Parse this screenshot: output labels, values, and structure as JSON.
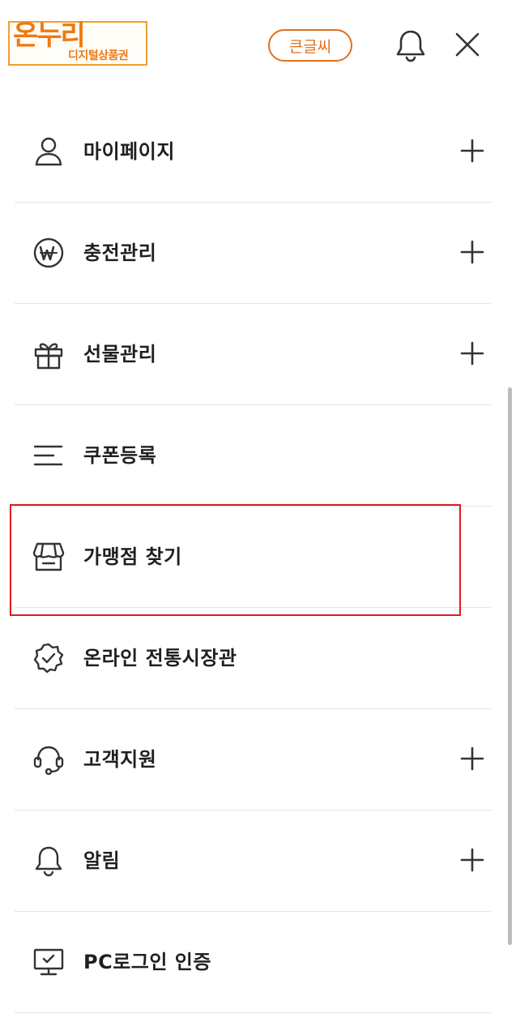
{
  "header": {
    "logo_main": "온누리",
    "logo_sub": "디지털상품권",
    "big_font_label": "큰글씨",
    "bell_icon": "bell-icon",
    "close_icon": "close-icon"
  },
  "menu": {
    "items": [
      {
        "label": "마이페이지",
        "icon": "user-icon",
        "expandable": true
      },
      {
        "label": "충전관리",
        "icon": "won-coin-icon",
        "expandable": true
      },
      {
        "label": "선물관리",
        "icon": "gift-icon",
        "expandable": true
      },
      {
        "label": "쿠폰등록",
        "icon": "list-lines-icon",
        "expandable": false
      },
      {
        "label": "가맹점 찾기",
        "icon": "store-icon",
        "expandable": false
      },
      {
        "label": "온라인 전통시장관",
        "icon": "verified-badge-icon",
        "expandable": false
      },
      {
        "label": "고객지원",
        "icon": "headset-icon",
        "expandable": true
      },
      {
        "label": "알림",
        "icon": "bell-icon",
        "expandable": true
      },
      {
        "label": "PC로그인 인증",
        "icon": "monitor-check-icon",
        "expandable": false
      }
    ]
  },
  "colors": {
    "accent": "#e36f1e",
    "logo": "#ee7a12",
    "highlight": "#e01b1b",
    "divider": "#e3e3e3"
  }
}
